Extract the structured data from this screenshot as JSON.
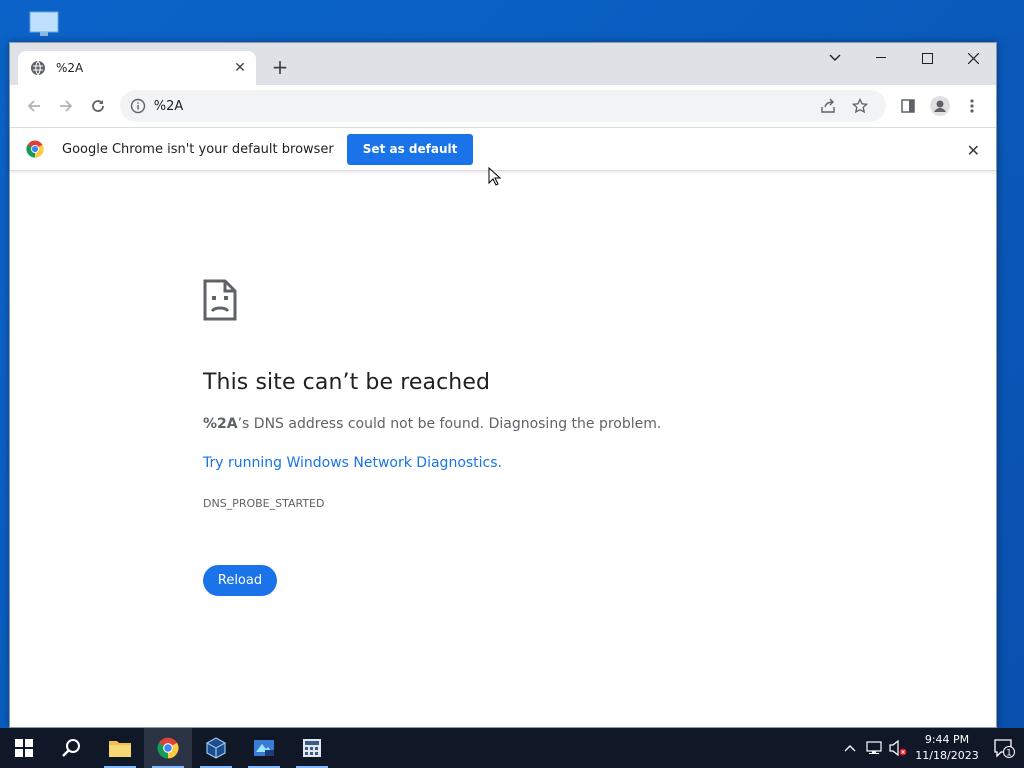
{
  "browser": {
    "tab_title": "%2A",
    "url": "%2A"
  },
  "infobar": {
    "message": "Google Chrome isn't your default browser",
    "button_label": "Set as default"
  },
  "error_page": {
    "title": "This site can’t be reached",
    "host": "%2A",
    "description": "’s DNS address could not be found. Diagnosing the problem.",
    "link_text": "Try running Windows Network Diagnostics.",
    "error_code": "DNS_PROBE_STARTED",
    "reload_label": "Reload"
  },
  "taskbar": {
    "apps": [
      "start-icon",
      "search-icon",
      "file-explorer-icon",
      "chrome-icon",
      "virtualbox-icon",
      "app-xp-icon",
      "calculator-app-icon"
    ],
    "time": "9:44 PM",
    "date": "11/18/2023",
    "notification_count": "1"
  },
  "colors": {
    "accent": "#1a73e8",
    "desktop": "#0a5ec0",
    "taskbar": "#101827"
  }
}
